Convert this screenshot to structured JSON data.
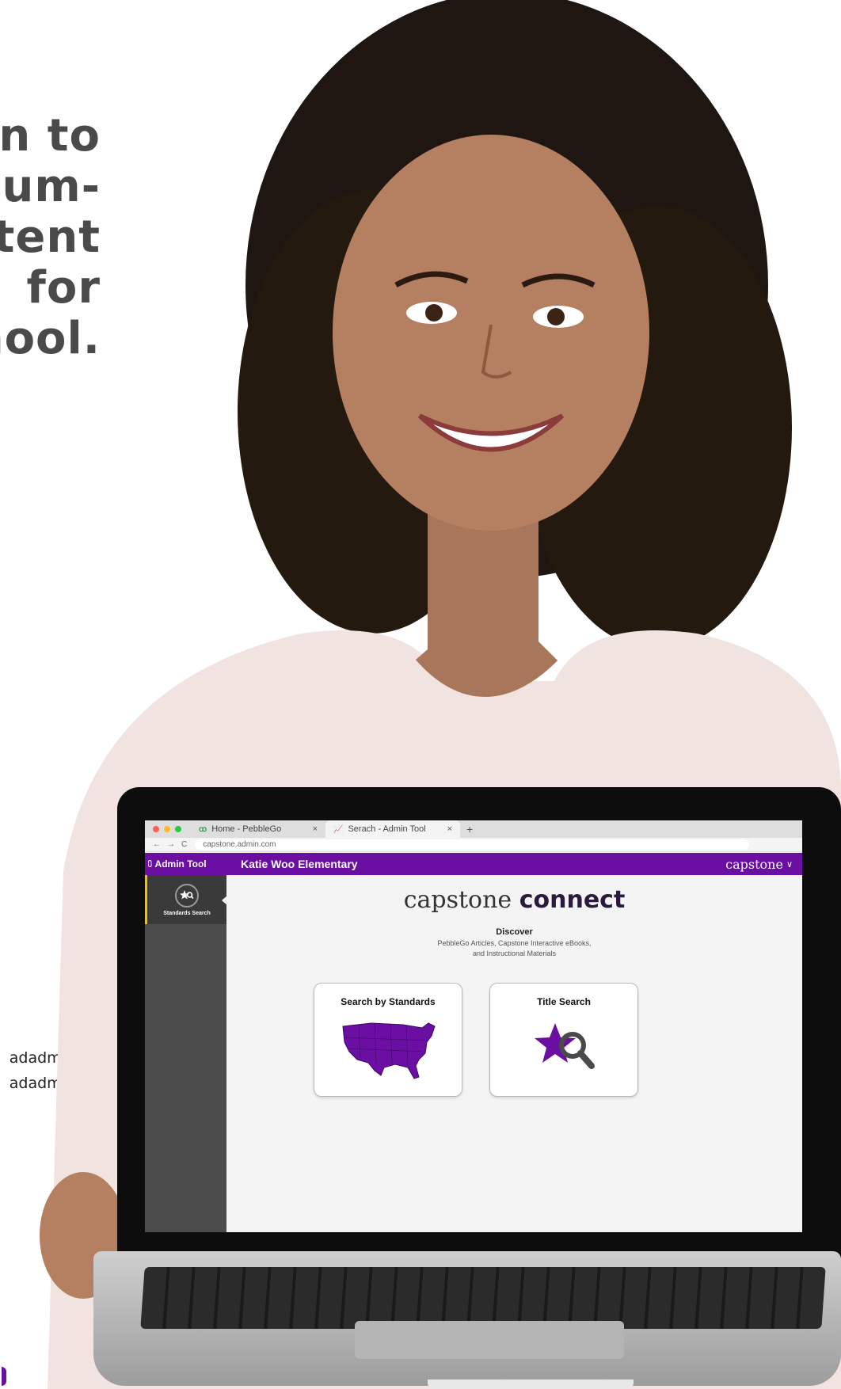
{
  "headline": {
    "lines": [
      "n to",
      "um-",
      "tent",
      "for",
      "hool."
    ]
  },
  "side_note": {
    "lines": [
      "adadmin",
      "adadmin"
    ]
  },
  "browser": {
    "tabs": [
      {
        "label": "Home - PebbleGo",
        "close": "×",
        "icon": "pebblego-icon"
      },
      {
        "label": "Serach - Admin Tool",
        "close": "×",
        "icon": "admin-chart-icon",
        "active": true
      }
    ],
    "new_tab": "+",
    "nav": {
      "back": "←",
      "forward": "→",
      "reload": "C"
    },
    "url": "capstone.admin.com"
  },
  "app": {
    "tool_label": "Admin Tool",
    "school_name": "Katie Woo Elementary",
    "brand": "capstone",
    "brand_chevron": "∨",
    "accent": "#6b0fa3",
    "sidebar": {
      "items": [
        {
          "label": "Standards Search",
          "icon": "star-search-icon",
          "active": true
        }
      ]
    },
    "logo": {
      "part1": "capstone",
      "part2": "connect"
    },
    "discover_title": "Discover",
    "discover_desc_line1": "PebbleGo Articles, Capstone Interactive eBooks,",
    "discover_desc_line2": "and Instructional Materials",
    "cards": [
      {
        "title": "Search by Standards",
        "icon": "usa-map-icon"
      },
      {
        "title": "Title Search",
        "icon": "star-magnifier-icon"
      }
    ]
  }
}
